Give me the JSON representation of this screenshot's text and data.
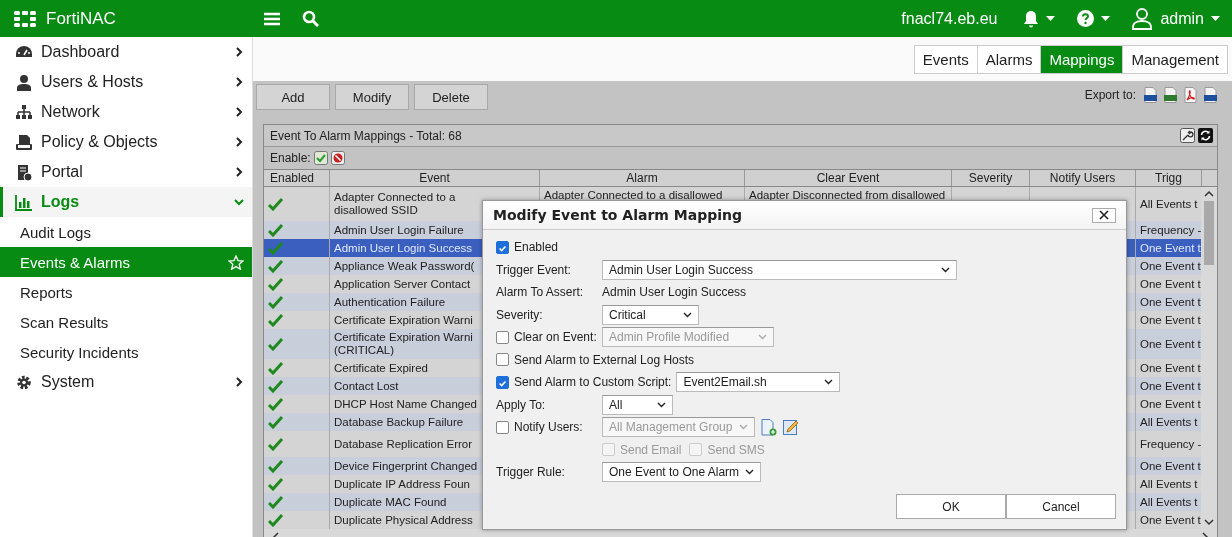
{
  "header": {
    "product": "FortiNAC",
    "host": "fnacl74.eb.eu",
    "user": "admin"
  },
  "sidebar": {
    "items": [
      {
        "label": "Dashboard",
        "selected": false,
        "expanded": false
      },
      {
        "label": "Users & Hosts",
        "selected": false,
        "expanded": false
      },
      {
        "label": "Network",
        "selected": false,
        "expanded": false
      },
      {
        "label": "Policy & Objects",
        "selected": false,
        "expanded": false
      },
      {
        "label": "Portal",
        "selected": false,
        "expanded": false
      },
      {
        "label": "Logs",
        "selected": true,
        "expanded": true,
        "children": [
          {
            "label": "Audit Logs",
            "selected": false
          },
          {
            "label": "Events & Alarms",
            "selected": true
          },
          {
            "label": "Reports",
            "selected": false
          },
          {
            "label": "Scan Results",
            "selected": false
          },
          {
            "label": "Security Incidents",
            "selected": false
          }
        ]
      },
      {
        "label": "System",
        "selected": false,
        "expanded": false
      }
    ]
  },
  "tabs": [
    {
      "label": "Events",
      "selected": false
    },
    {
      "label": "Alarms",
      "selected": false
    },
    {
      "label": "Mappings",
      "selected": true
    },
    {
      "label": "Management",
      "selected": false
    }
  ],
  "toolbar": {
    "buttons": [
      "Add",
      "Modify",
      "Delete"
    ],
    "export_label": "Export to:"
  },
  "panel": {
    "title": "Event To Alarm Mappings - Total: 68",
    "enable_label": "Enable:"
  },
  "table": {
    "columns": [
      "Enabled",
      "Event",
      "Alarm",
      "Clear Event",
      "Severity",
      "Notify Users",
      "Trigg"
    ],
    "rows": [
      {
        "enabled": true,
        "selected": false,
        "event": "Adapter Connected to a disallowed SSID",
        "alarm": "Adapter Connected to a disallowed",
        "clear_event": "Adapter Disconnected from disallowed",
        "trigger": "All Events t"
      },
      {
        "enabled": true,
        "selected": false,
        "event": "Admin User Login Failure",
        "trigger": "Frequency -"
      },
      {
        "enabled": true,
        "selected": true,
        "event": "Admin User Login Success",
        "trigger": "One Event t"
      },
      {
        "enabled": true,
        "selected": false,
        "event": "Appliance Weak Password(",
        "trigger": "One Event t"
      },
      {
        "enabled": true,
        "selected": false,
        "event": "Application Server Contact",
        "trigger": "One Event t"
      },
      {
        "enabled": true,
        "selected": false,
        "event": "Authentication Failure",
        "trigger": "One Event t"
      },
      {
        "enabled": true,
        "selected": false,
        "event": "Certificate Expiration Warni",
        "trigger": "One Event t"
      },
      {
        "enabled": true,
        "selected": false,
        "event": "Certificate Expiration Warni (CRITICAL)",
        "trigger": "One Event t"
      },
      {
        "enabled": true,
        "selected": false,
        "event": "Certificate Expired",
        "trigger": "One Event t"
      },
      {
        "enabled": true,
        "selected": false,
        "event": "Contact Lost",
        "trigger": "One Event t"
      },
      {
        "enabled": true,
        "selected": false,
        "event": "DHCP Host Name Changed",
        "trigger": "One Event t"
      },
      {
        "enabled": true,
        "selected": false,
        "event": "Database Backup Failure",
        "trigger": "All Events t"
      },
      {
        "enabled": true,
        "selected": false,
        "event": "Database Replication Error",
        "trigger": "Frequency -"
      },
      {
        "enabled": true,
        "selected": false,
        "event": "Device Fingerprint Changed",
        "trigger": "One Event t"
      },
      {
        "enabled": true,
        "selected": false,
        "event": "Duplicate IP Address Foun",
        "trigger": "All Events t"
      },
      {
        "enabled": true,
        "selected": false,
        "event": "Duplicate MAC Found",
        "trigger": "All Events t"
      },
      {
        "enabled": true,
        "selected": false,
        "event": "Duplicate Physical Address",
        "trigger": "One Event t"
      }
    ]
  },
  "dialog": {
    "title": "Modify Event to Alarm Mapping",
    "enabled": {
      "label": "Enabled",
      "checked": true
    },
    "trigger_event": {
      "label": "Trigger Event:",
      "value": "Admin User Login Success"
    },
    "alarm_to_assert": {
      "label": "Alarm To Assert:",
      "value": "Admin User Login Success"
    },
    "severity": {
      "label": "Severity:",
      "value": "Critical"
    },
    "clear_on_event": {
      "label": "Clear on Event:",
      "checked": false,
      "value": "Admin Profile Modified"
    },
    "external_log_hosts": {
      "label": "Send Alarm to External Log Hosts",
      "checked": false
    },
    "custom_script": {
      "label": "Send Alarm to Custom Script:",
      "checked": true,
      "value": "Event2Email.sh"
    },
    "apply_to": {
      "label": "Apply To:",
      "value": "All"
    },
    "notify_users": {
      "label": "Notify Users:",
      "checked": false,
      "value": "All Management Group"
    },
    "send_email": {
      "label": "Send Email",
      "checked": false,
      "disabled": true
    },
    "send_sms": {
      "label": "Send SMS",
      "checked": false,
      "disabled": true
    },
    "trigger_rule": {
      "label": "Trigger Rule:",
      "value": "One Event to One Alarm"
    },
    "buttons": [
      "OK",
      "Cancel"
    ]
  }
}
